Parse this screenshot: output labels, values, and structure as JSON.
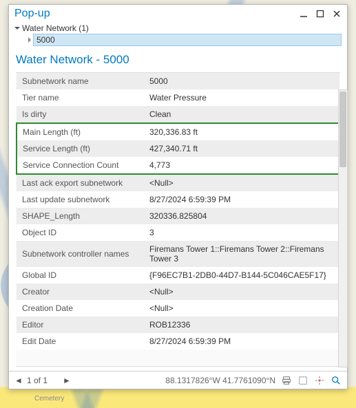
{
  "window": {
    "title": "Pop-up"
  },
  "tree": {
    "root_label": "Water Network (1)",
    "selected_label": "5000"
  },
  "content_title": "Water Network - 5000",
  "highlight_rows": [
    "main_length",
    "service_length",
    "service_conn_count"
  ],
  "attributes": [
    {
      "id": "subnet_name",
      "label": "Subnetwork name",
      "value": "5000"
    },
    {
      "id": "tier_name",
      "label": "Tier name",
      "value": "Water Pressure"
    },
    {
      "id": "is_dirty",
      "label": "Is dirty",
      "value": "Clean"
    },
    {
      "id": "main_length",
      "label": "Main Length (ft)",
      "value": "320,336.83 ft"
    },
    {
      "id": "service_length",
      "label": "Service Length (ft)",
      "value": "427,340.71 ft"
    },
    {
      "id": "service_conn_count",
      "label": "Service Connection Count",
      "value": "4,773"
    },
    {
      "id": "last_ack_export",
      "label": "Last ack export subnetwork",
      "value": "<Null>"
    },
    {
      "id": "last_update_subnet",
      "label": "Last update subnetwork",
      "value": "8/27/2024 6:59:39 PM"
    },
    {
      "id": "shape_length",
      "label": "SHAPE_Length",
      "value": "320336.825804"
    },
    {
      "id": "object_id",
      "label": "Object ID",
      "value": "3"
    },
    {
      "id": "subnet_ctrl_names",
      "label": "Subnetwork controller names",
      "value": "Firemans Tower 1::Firemans Tower 2::Firemans Tower 3"
    },
    {
      "id": "global_id",
      "label": "Global ID",
      "value": "{F96EC7B1-2DB0-44D7-B144-5C046CAE5F17}"
    },
    {
      "id": "creator",
      "label": "Creator",
      "value": "<Null>"
    },
    {
      "id": "creation_date",
      "label": "Creation Date",
      "value": "<Null>"
    },
    {
      "id": "editor",
      "label": "Editor",
      "value": "ROB12336"
    },
    {
      "id": "edit_date",
      "label": "Edit Date",
      "value": "8/27/2024 6:59:39 PM"
    }
  ],
  "status": {
    "record_counter": "1 of 1",
    "coordinates": "88.1317826°W 41.7761090°N"
  },
  "map_labels": {
    "cemetery": "Cemetery"
  }
}
